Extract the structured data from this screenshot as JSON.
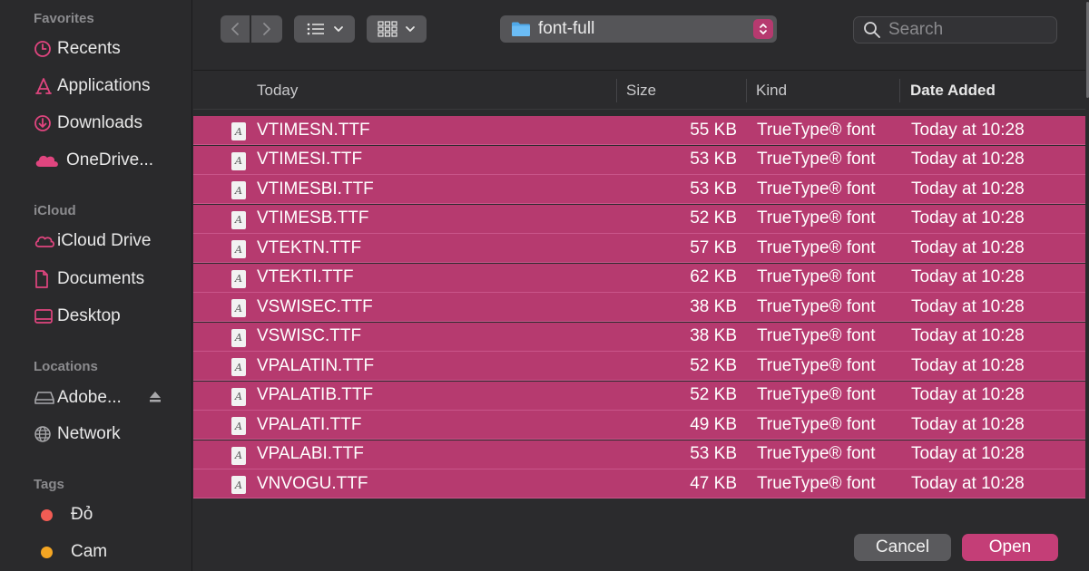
{
  "sidebar": {
    "favorites_heading": "Favorites",
    "favorites": [
      {
        "label": "Recents",
        "icon": "clock-icon"
      },
      {
        "label": "Applications",
        "icon": "applications-icon"
      },
      {
        "label": "Downloads",
        "icon": "download-icon"
      },
      {
        "label": "OneDrive...",
        "icon": "cloud-filled-icon"
      }
    ],
    "icloud_heading": "iCloud",
    "icloud": [
      {
        "label": "iCloud Drive",
        "icon": "cloud-icon"
      },
      {
        "label": "Documents",
        "icon": "document-icon"
      },
      {
        "label": "Desktop",
        "icon": "desktop-icon"
      }
    ],
    "locations_heading": "Locations",
    "locations": [
      {
        "label": "Adobe...",
        "icon": "drive-icon"
      },
      {
        "label": "Network",
        "icon": "globe-icon"
      }
    ],
    "tags_heading": "Tags",
    "tags": [
      {
        "label": "Đỏ",
        "color": "#f25c54"
      },
      {
        "label": "Cam",
        "color": "#f5a623"
      }
    ]
  },
  "toolbar": {
    "path_label": "font-full",
    "search_placeholder": "Search"
  },
  "columns": {
    "name": "Today",
    "size": "Size",
    "kind": "Kind",
    "date_added": "Date Added"
  },
  "files": [
    {
      "name": "VTIMESN.TTF",
      "size": "55 KB",
      "kind": "TrueType® font",
      "date": "Today at 10:28"
    },
    {
      "name": "VTIMESI.TTF",
      "size": "53 KB",
      "kind": "TrueType® font",
      "date": "Today at 10:28"
    },
    {
      "name": "VTIMESBI.TTF",
      "size": "53 KB",
      "kind": "TrueType® font",
      "date": "Today at 10:28"
    },
    {
      "name": "VTIMESB.TTF",
      "size": "52 KB",
      "kind": "TrueType® font",
      "date": "Today at 10:28"
    },
    {
      "name": "VTEKTN.TTF",
      "size": "57 KB",
      "kind": "TrueType® font",
      "date": "Today at 10:28"
    },
    {
      "name": "VTEKTI.TTF",
      "size": "62 KB",
      "kind": "TrueType® font",
      "date": "Today at 10:28"
    },
    {
      "name": "VSWISEC.TTF",
      "size": "38 KB",
      "kind": "TrueType® font",
      "date": "Today at 10:28"
    },
    {
      "name": "VSWISC.TTF",
      "size": "38 KB",
      "kind": "TrueType® font",
      "date": "Today at 10:28"
    },
    {
      "name": "VPALATIN.TTF",
      "size": "52 KB",
      "kind": "TrueType® font",
      "date": "Today at 10:28"
    },
    {
      "name": "VPALATIB.TTF",
      "size": "52 KB",
      "kind": "TrueType® font",
      "date": "Today at 10:28"
    },
    {
      "name": "VPALATI.TTF",
      "size": "49 KB",
      "kind": "TrueType® font",
      "date": "Today at 10:28"
    },
    {
      "name": "VPALABI.TTF",
      "size": "53 KB",
      "kind": "TrueType® font",
      "date": "Today at 10:28"
    },
    {
      "name": "VNVOGU.TTF",
      "size": "47 KB",
      "kind": "TrueType® font",
      "date": "Today at 10:28"
    }
  ],
  "footer": {
    "cancel_label": "Cancel",
    "open_label": "Open"
  },
  "colors": {
    "accent": "#b63a6f",
    "open_button": "#c43e77"
  }
}
